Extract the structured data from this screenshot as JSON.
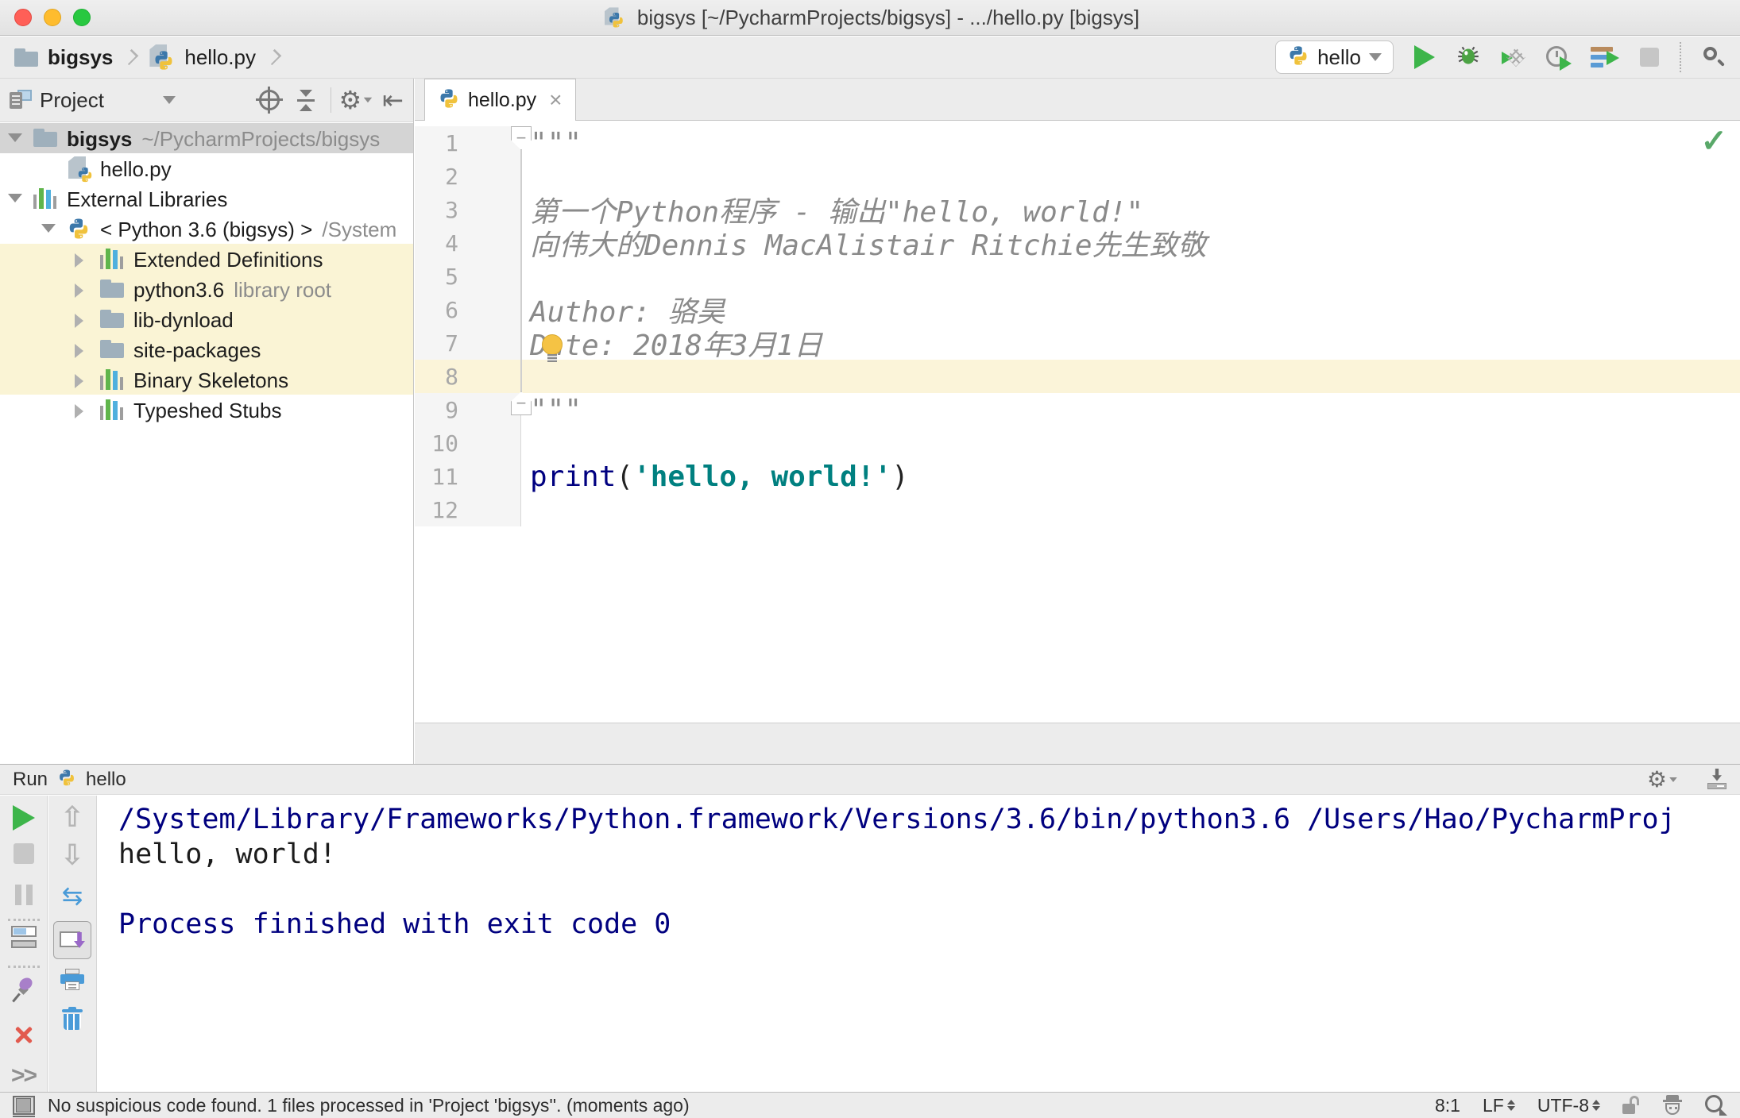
{
  "window": {
    "title": "bigsys [~/PycharmProjects/bigsys] - .../hello.py [bigsys]"
  },
  "navbar": {
    "breadcrumbs": {
      "items": [
        {
          "label": "bigsys"
        },
        {
          "label": "hello.py"
        }
      ]
    },
    "run_config": {
      "label": "hello"
    },
    "toolbar_icons": [
      "run",
      "debug",
      "run-with-coverage",
      "profile",
      "concurrency-diagram",
      "stop",
      "search-everywhere"
    ]
  },
  "project_panel": {
    "title": "Project",
    "header_icons": [
      "locate",
      "collapse-all",
      "settings",
      "hide-side-panel"
    ],
    "tree": [
      {
        "level": 0,
        "chevron": "down",
        "icon": "folder",
        "label": "bigsys",
        "bold": true,
        "suffix": "~/PycharmProjects/bigsys",
        "selected": true
      },
      {
        "level": 1,
        "chevron": null,
        "icon": "python-file",
        "label": "hello.py"
      },
      {
        "level": 0,
        "chevron": "down",
        "icon": "library",
        "label": "External Libraries"
      },
      {
        "level": 1,
        "chevron": "down",
        "icon": "python",
        "label": "< Python 3.6 (bigsys) >",
        "suffix": "/System"
      },
      {
        "level": 2,
        "chevron": "right",
        "icon": "library",
        "label": "Extended Definitions",
        "highlighted": true
      },
      {
        "level": 2,
        "chevron": "right",
        "icon": "folder",
        "label": "python3.6",
        "suffix": "library root",
        "highlighted": true
      },
      {
        "level": 2,
        "chevron": "right",
        "icon": "folder",
        "label": "lib-dynload",
        "highlighted": true
      },
      {
        "level": 2,
        "chevron": "right",
        "icon": "folder",
        "label": "site-packages",
        "highlighted": true
      },
      {
        "level": 2,
        "chevron": "right",
        "icon": "library",
        "label": "Binary Skeletons",
        "highlighted": true
      },
      {
        "level": 2,
        "chevron": "right",
        "icon": "library",
        "label": "Typeshed Stubs"
      }
    ]
  },
  "editor": {
    "tab_label": "hello.py",
    "lines": [
      {
        "n": 1,
        "seg": [
          {
            "t": "\"\"\"",
            "c": "comment"
          }
        ]
      },
      {
        "n": 2,
        "seg": []
      },
      {
        "n": 3,
        "seg": [
          {
            "t": "第一个Python程序 - 输出\"hello, world!\"",
            "c": "comment"
          }
        ]
      },
      {
        "n": 4,
        "seg": [
          {
            "t": "向伟大的Dennis MacAlistair Ritchie先生致敬",
            "c": "comment"
          }
        ]
      },
      {
        "n": 5,
        "seg": []
      },
      {
        "n": 6,
        "seg": [
          {
            "t": "Author: 骆昊",
            "c": "comment"
          }
        ]
      },
      {
        "n": 7,
        "seg": [
          {
            "t": "Date: 2018年3月1日",
            "c": "comment"
          }
        ]
      },
      {
        "n": 8,
        "seg": [],
        "highlighted": true
      },
      {
        "n": 9,
        "seg": [
          {
            "t": "\"\"\"",
            "c": "comment"
          }
        ]
      },
      {
        "n": 10,
        "seg": []
      },
      {
        "n": 11,
        "seg": [
          {
            "t": "print",
            "c": "keyword"
          },
          {
            "t": "(",
            "c": "plain"
          },
          {
            "t": "'hello, world!'",
            "c": "string"
          },
          {
            "t": ")",
            "c": "plain"
          }
        ]
      },
      {
        "n": 12,
        "seg": []
      }
    ]
  },
  "run_panel": {
    "title": "Run",
    "config_name": "hello",
    "header_icons": [
      "settings",
      "scroll-down"
    ],
    "left_toolbar_icons": [
      "rerun",
      "stop",
      "pause-output",
      "restore-layout",
      "pin-tab",
      "close",
      "more"
    ],
    "console_toolbar_icons": [
      "up-the-stack-trace",
      "down-the-stack-trace",
      "use-soft-wraps",
      "scroll-to-the-end",
      "print",
      "clear-all"
    ],
    "console_lines": [
      {
        "t": "/System/Library/Frameworks/Python.framework/Versions/3.6/bin/python3.6 /Users/Hao/PycharmProj",
        "c": "sys"
      },
      {
        "t": "hello, world!",
        "c": "plain"
      },
      {
        "t": "",
        "c": "plain"
      },
      {
        "t": "Process finished with exit code 0",
        "c": "sys"
      }
    ]
  },
  "status_bar": {
    "message": "No suspicious code found. 1 files processed in 'Project 'bigsys''. (moments ago)",
    "caret_position": "8:1",
    "line_separator": "LF",
    "encoding": "UTF-8",
    "right_icons": [
      "unlock",
      "hector-inspections",
      "feedback"
    ]
  },
  "colors": {
    "selection_gray": "#d4d4d4",
    "library_scope_yellow": "#faf4d5",
    "current_line_yellow": "#fbf4d9",
    "console_system_blue": "#00007f",
    "keyword_blue": "#000080",
    "string_teal": "#008080",
    "comment_gray": "#8a8a8a",
    "run_green": "#3db54a"
  }
}
